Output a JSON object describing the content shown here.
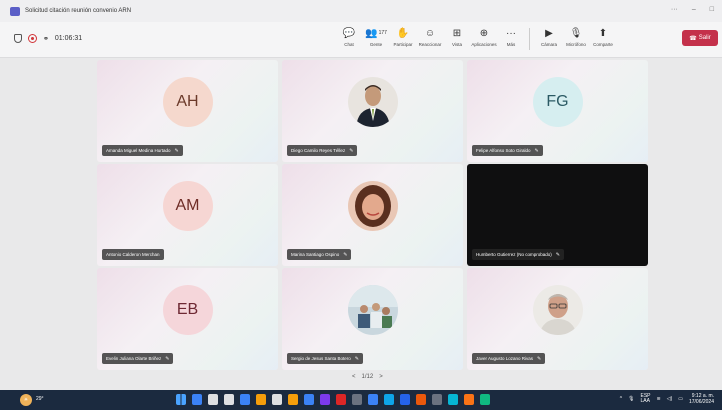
{
  "window": {
    "title": "Solicitud citación reunión convenio ARN",
    "controls": [
      "···",
      "–",
      "□"
    ]
  },
  "meeting": {
    "timer": "01:06:31",
    "toolbar": [
      {
        "icon": "chat-icon",
        "glyph": "💬",
        "label": "Chat"
      },
      {
        "icon": "people-icon",
        "glyph": "👥",
        "label": "Gente",
        "badge": "177"
      },
      {
        "icon": "raise-hand-icon",
        "glyph": "✋",
        "label": "Participar"
      },
      {
        "icon": "react-icon",
        "glyph": "☺",
        "label": "Reaccionar"
      },
      {
        "icon": "view-icon",
        "glyph": "⊞",
        "label": "Vista"
      },
      {
        "icon": "apps-icon",
        "glyph": "⊕",
        "label": "Aplicaciones"
      },
      {
        "icon": "more-icon",
        "glyph": "···",
        "label": "Más"
      }
    ],
    "devices": [
      {
        "icon": "camera-icon",
        "glyph": "▶",
        "label": "Cámara"
      },
      {
        "icon": "microphone-icon",
        "glyph": "🎙",
        "label": "Micrófono"
      },
      {
        "icon": "share-icon",
        "glyph": "⬆",
        "label": "Comparte"
      }
    ],
    "leave_label": "Salir",
    "pager": {
      "prev": "<",
      "page": "1/12",
      "next": ">"
    }
  },
  "participants": [
    {
      "name": "Amanda Miguel Medina Hurtado",
      "initials": "AH",
      "type": "initials",
      "color": "#f5d8cd",
      "textColor": "#6b3a2a"
    },
    {
      "name": "Diego Camilo Reyes Téllez",
      "initials": "",
      "type": "photo",
      "photo": "man-suit"
    },
    {
      "name": "Felipe Alfonso Soto Giraldo",
      "initials": "FG",
      "type": "initials",
      "color": "#d6eef0",
      "textColor": "#2b5a64"
    },
    {
      "name": "Antonio Calderon Merchan",
      "initials": "AM",
      "type": "initials",
      "color": "#f6d6d3",
      "textColor": "#6e2c26"
    },
    {
      "name": "Marina Santiago Ospino",
      "initials": "",
      "type": "photo",
      "photo": "woman"
    },
    {
      "name": "Humberto Gutierrez (No comprobado)",
      "initials": "",
      "type": "dark"
    },
    {
      "name": "Evelin Juliana Olarte Briñez",
      "initials": "EB",
      "type": "initials",
      "color": "#f5d6da",
      "textColor": "#6e2933"
    },
    {
      "name": "Sergio de Jesus Santa Botero",
      "initials": "",
      "type": "photo",
      "photo": "group"
    },
    {
      "name": "Javer Augusto Lozano Rivas",
      "initials": "",
      "type": "photo",
      "photo": "man-glasses"
    }
  ],
  "taskbar": {
    "weather": "29°",
    "lang": "ESP",
    "lang2": "LAA",
    "time": "9:12 a. m.",
    "date": "17/06/2024",
    "apps": [
      "#3b82f6",
      "#ffffff",
      "#ffffff",
      "#3b82f6",
      "#f59e0b",
      "#ffffff",
      "#f59e0b",
      "#3b82f6",
      "#7c3aed",
      "#dc2626",
      "#6b7280",
      "#3b82f6",
      "#0ea5e9",
      "#2563eb",
      "#ea580c",
      "#6b7280",
      "#06b6d4",
      "#f97316",
      "#10b981"
    ]
  }
}
